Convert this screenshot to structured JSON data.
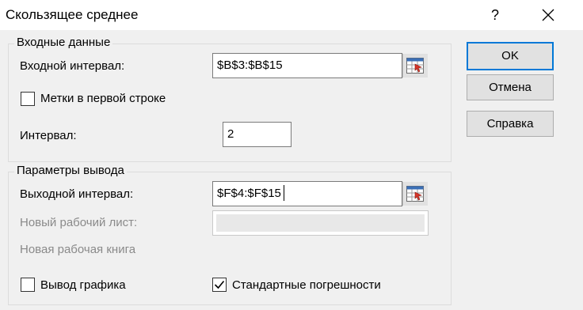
{
  "window": {
    "title": "Скользящее среднее",
    "help_glyph": "?"
  },
  "input_group": {
    "legend": "Входные данные",
    "range_label": "Входной интервал:",
    "range_value": "$B$3:$B$15",
    "labels_checkbox": {
      "label": "Метки в первой строке",
      "checked": false
    },
    "interval_label": "Интервал:",
    "interval_value": "2"
  },
  "output_group": {
    "legend": "Параметры вывода",
    "range_label": "Выходной интервал:",
    "range_value": "$F$4:$F$15",
    "new_sheet_label": "Новый рабочий лист:",
    "new_workbook_label": "Новая рабочая книга",
    "chart_checkbox": {
      "label": "Вывод графика",
      "checked": false
    },
    "stderr_checkbox": {
      "label": "Стандартные погрешности",
      "checked": true
    }
  },
  "buttons": {
    "ok": "OK",
    "cancel": "Отмена",
    "help": "Справка"
  },
  "icons": {
    "close": "close-icon",
    "range_picker": "range-select-icon",
    "check": "check-icon"
  }
}
